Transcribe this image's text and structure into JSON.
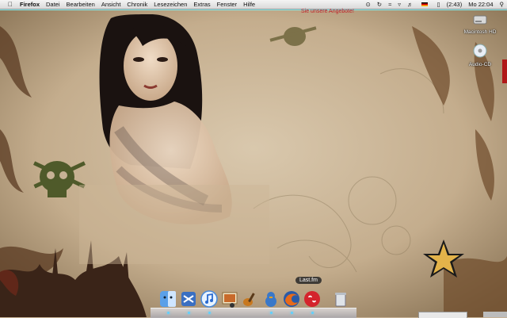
{
  "menubar": {
    "app_name": "Firefox",
    "items": [
      "Datei",
      "Bearbeiten",
      "Ansicht",
      "Chronik",
      "Lesezeichen",
      "Extras",
      "Fenster",
      "Hilfe"
    ],
    "battery": "(2:43)",
    "clock": "Mo 22:04"
  },
  "notice": "Sie unsere Angebote!",
  "desktop_icons": [
    {
      "label": "Macintosh HD",
      "icon": "hard-drive-icon"
    },
    {
      "label": "Audio-CD",
      "icon": "cd-icon"
    }
  ],
  "dock": {
    "tooltip": "Last.fm",
    "items": [
      {
        "name": "finder",
        "icon": "finder-icon"
      },
      {
        "name": "mail",
        "icon": "mail-icon"
      },
      {
        "name": "itunes",
        "icon": "itunes-icon"
      },
      {
        "name": "iphoto",
        "icon": "iphoto-icon"
      },
      {
        "name": "garageband",
        "icon": "guitar-icon"
      },
      {
        "name": "adium",
        "icon": "duck-icon"
      },
      {
        "name": "firefox",
        "icon": "firefox-icon"
      },
      {
        "name": "lastfm",
        "icon": "lastfm-icon"
      },
      {
        "name": "trash",
        "icon": "trash-icon"
      }
    ]
  },
  "colors": {
    "wallpaper": "#c7b295",
    "menubar": "#e6e6e6",
    "accent_red": "#c0202a"
  }
}
